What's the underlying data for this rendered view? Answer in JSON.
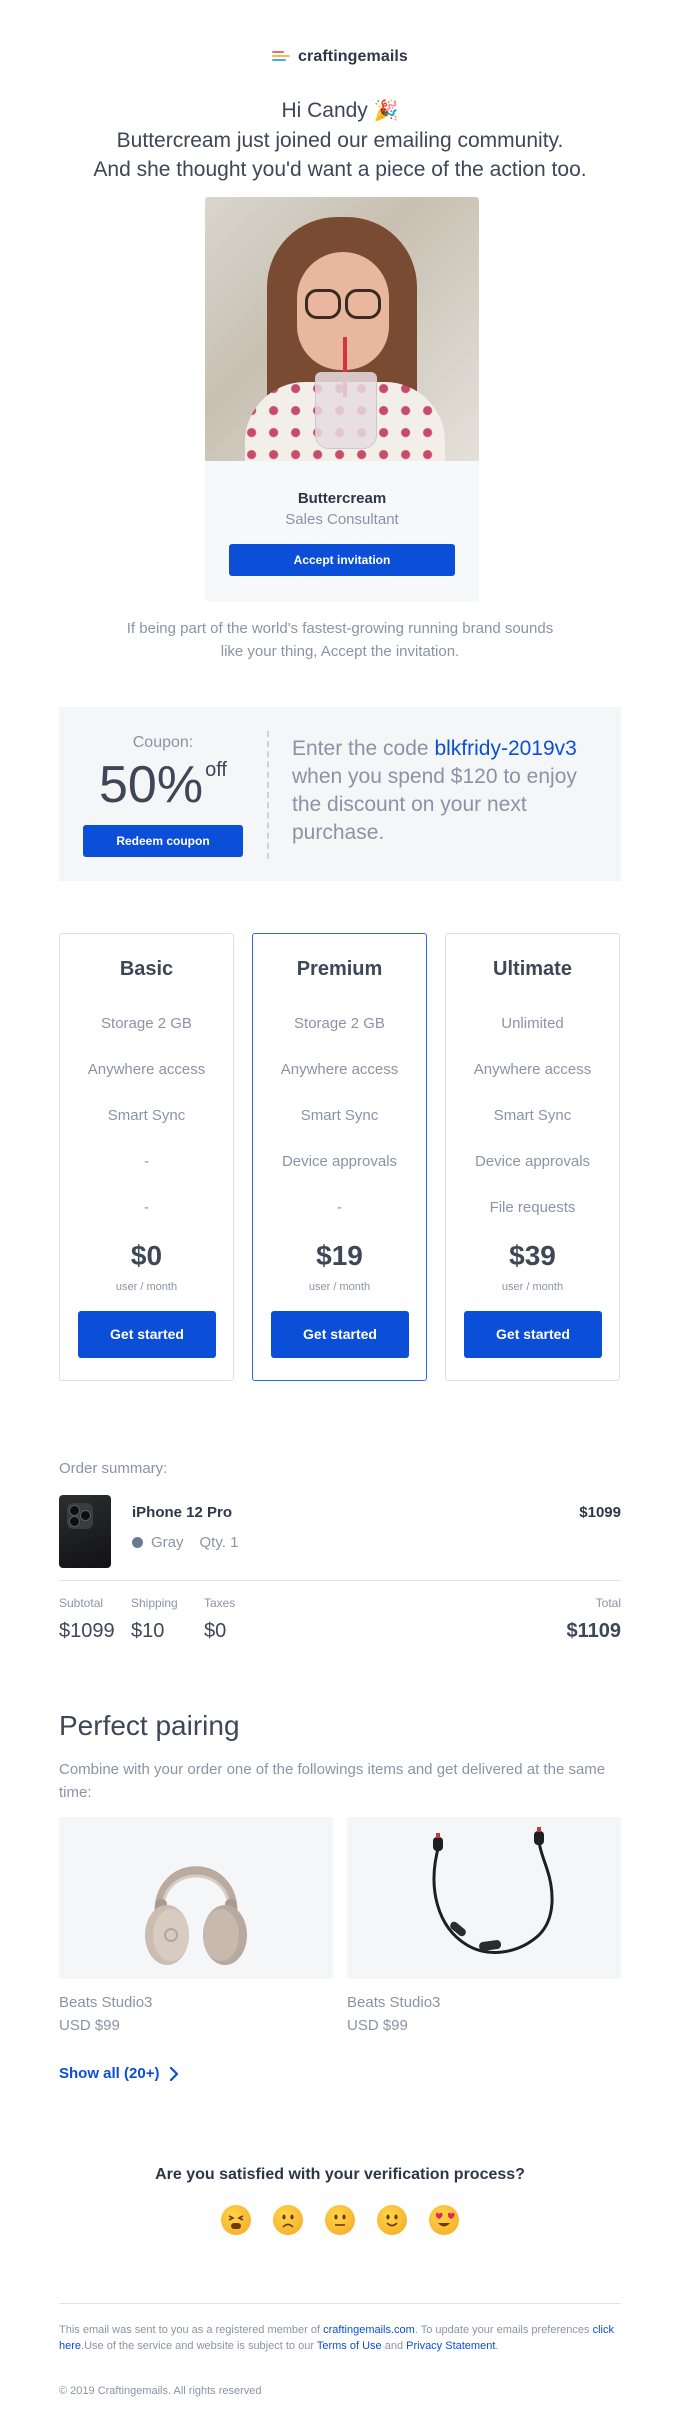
{
  "brand": {
    "name": "craftingemails",
    "accent": "#0b4fd8"
  },
  "hero": {
    "greeting": "Hi Candy",
    "line2": "Buttercream just joined our emailing community.",
    "line3": "And she thought you'd want a piece of the action too."
  },
  "invite": {
    "name": "Buttercream",
    "role": "Sales Consultant",
    "button": "Accept invitation",
    "note": "If being part of the world's fastest-growing running brand sounds like your thing, Accept the invitation."
  },
  "coupon": {
    "label": "Coupon:",
    "amount": "50%",
    "suffix": "off",
    "button": "Redeem coupon",
    "text_before": "Enter the code",
    "code": "blkfridy-2019v3",
    "text_after": "when you spend $120 to enjoy the discount on your next purchase."
  },
  "plans": [
    {
      "name": "Basic",
      "features": [
        "Storage 2 GB",
        "Anywhere access",
        "Smart Sync",
        "-",
        "-"
      ],
      "price": "$0",
      "unit": "user / month",
      "button": "Get started"
    },
    {
      "name": "Premium",
      "features": [
        "Storage 2 GB",
        "Anywhere access",
        "Smart Sync",
        "Device approvals",
        "-"
      ],
      "price": "$19",
      "unit": "user / month",
      "button": "Get started"
    },
    {
      "name": "Ultimate",
      "features": [
        "Unlimited",
        "Anywhere access",
        "Smart Sync",
        "Device approvals",
        "File requests"
      ],
      "price": "$39",
      "unit": "user / month",
      "button": "Get started"
    }
  ],
  "order": {
    "label": "Order summary:",
    "item": {
      "name": "iPhone 12 Pro",
      "price": "$1099",
      "color": "Gray",
      "qty": "Qty. 1"
    },
    "totals": {
      "subtotal_label": "Subtotal",
      "subtotal": "$1099",
      "shipping_label": "Shipping",
      "shipping": "$10",
      "taxes_label": "Taxes",
      "taxes": "$0",
      "total_label": "Total",
      "total": "$1109"
    }
  },
  "pairing": {
    "title": "Perfect pairing",
    "description": "Combine with your order one of the followings items and get delivered at the same time:",
    "items": [
      {
        "name": "Beats Studio3",
        "price": "USD $99"
      },
      {
        "name": "Beats Studio3",
        "price": "USD $99"
      }
    ],
    "show_all": "Show all (20+)"
  },
  "survey": {
    "question": "Are you satisfied with your verification process?",
    "options": [
      "tired-face-emoji",
      "slightly-frowning-emoji",
      "neutral-face-emoji",
      "slightly-smiling-emoji",
      "heart-eyes-emoji"
    ]
  },
  "footer": {
    "t1": "This email was sent to you as a registered member of",
    "link_site": "craftingemails.com",
    "t2": ". To update your emails preferences",
    "link_here": "click here",
    "t3": ".Use of the service and website is subject to our",
    "link_terms": "Terms of Use",
    "t4": "and",
    "link_privacy": "Privacy Statement",
    "t5": ".",
    "copyright": "© 2019 Craftingemails. All rights reserved"
  }
}
